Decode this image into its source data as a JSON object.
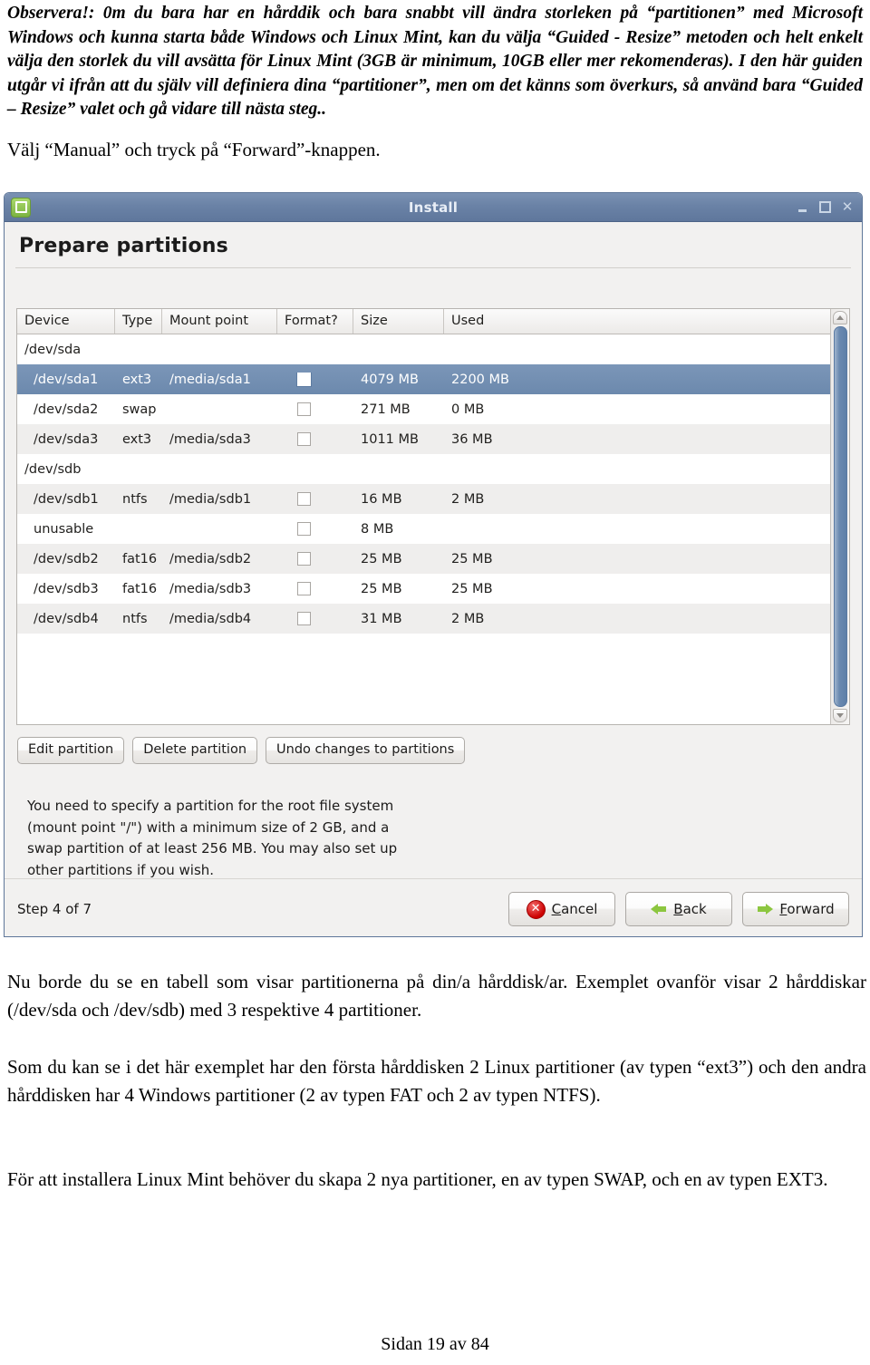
{
  "document": {
    "intro_paragraph": "Observera!: 0m du bara har en hårddik och bara snabbt vill ändra storleken på “partitionen” med Microsoft Windows och kunna starta både Windows och Linux Mint, kan du välja “Guided - Resize” metoden och helt enkelt  välja den storlek du vill avsätta för Linux Mint (3GB är minimum, 10GB eller mer rekomenderas). I den här guiden utgår vi ifrån att du själv vill definiera dina “partitioner”, men om det känns som överkurs, så använd  bara “Guided – Resize” valet och gå vidare till nästa steg..",
    "instruction": "Välj “Manual” och tryck på “Forward”-knappen.",
    "after_paragraph_1": "Nu borde du se en tabell som visar partitionerna på din/a hårddisk/ar. Exemplet ovanför visar  2 hårddiskar (/dev/sda och /dev/sdb) med 3 respektive 4 partitioner.",
    "after_paragraph_2": "Som du kan se i det här exemplet har den första hårddisken 2 Linux partitioner (av typen “ext3”) och den andra hårddisken  har 4 Windows partitioner (2 av typen FAT och 2 av typen NTFS).",
    "after_paragraph_3": "För att installera Linux Mint behöver du skapa  2 nya partitioner, en av typen SWAP, och en av typen EXT3.",
    "footer": "Sidan 19 av 84"
  },
  "window": {
    "title": "Install",
    "icon": "linux-mint-logo",
    "controls": {
      "minimize": "_",
      "maximize": "□",
      "close": "✕"
    },
    "heading": "Prepare partitions",
    "table": {
      "columns": [
        "Device",
        "Type",
        "Mount point",
        "Format?",
        "Size",
        "Used"
      ],
      "rows": [
        {
          "kind": "disk",
          "device": "/dev/sda",
          "type": "",
          "mount": "",
          "format": false,
          "has_checkbox": false,
          "size": "",
          "used": "",
          "selected": false,
          "alt": false
        },
        {
          "kind": "partition",
          "device": "/dev/sda1",
          "type": "ext3",
          "mount": "/media/sda1",
          "format": false,
          "has_checkbox": true,
          "size": "4079 MB",
          "used": "2200 MB",
          "selected": true,
          "alt": false
        },
        {
          "kind": "partition",
          "device": "/dev/sda2",
          "type": "swap",
          "mount": "",
          "format": false,
          "has_checkbox": true,
          "size": "271 MB",
          "used": "0 MB",
          "selected": false,
          "alt": false
        },
        {
          "kind": "partition",
          "device": "/dev/sda3",
          "type": "ext3",
          "mount": "/media/sda3",
          "format": false,
          "has_checkbox": true,
          "size": "1011 MB",
          "used": "36 MB",
          "selected": false,
          "alt": true
        },
        {
          "kind": "disk",
          "device": "/dev/sdb",
          "type": "",
          "mount": "",
          "format": false,
          "has_checkbox": false,
          "size": "",
          "used": "",
          "selected": false,
          "alt": false
        },
        {
          "kind": "partition",
          "device": "/dev/sdb1",
          "type": "ntfs",
          "mount": "/media/sdb1",
          "format": false,
          "has_checkbox": true,
          "size": "16 MB",
          "used": "2 MB",
          "selected": false,
          "alt": true
        },
        {
          "kind": "partition",
          "device": "unusable",
          "type": "",
          "mount": "",
          "format": false,
          "has_checkbox": true,
          "size": "8 MB",
          "used": "",
          "selected": false,
          "alt": false
        },
        {
          "kind": "partition",
          "device": "/dev/sdb2",
          "type": "fat16",
          "mount": "/media/sdb2",
          "format": false,
          "has_checkbox": true,
          "size": "25 MB",
          "used": "25 MB",
          "selected": false,
          "alt": true
        },
        {
          "kind": "partition",
          "device": "/dev/sdb3",
          "type": "fat16",
          "mount": "/media/sdb3",
          "format": false,
          "has_checkbox": true,
          "size": "25 MB",
          "used": "25 MB",
          "selected": false,
          "alt": false
        },
        {
          "kind": "partition",
          "device": "/dev/sdb4",
          "type": "ntfs",
          "mount": "/media/sdb4",
          "format": false,
          "has_checkbox": true,
          "size": "31 MB",
          "used": "2 MB",
          "selected": false,
          "alt": true
        }
      ]
    },
    "buttons": {
      "edit_partition": "Edit partition",
      "delete_partition": "Delete partition",
      "undo_changes": "Undo changes to partitions"
    },
    "help_text": "You need to specify a partition for the root file system (mount point \"/\") with a minimum size of 2 GB, and a swap partition of at least 256 MB. You may also set up other partitions if you wish.",
    "footer": {
      "step": "Step 4 of 7",
      "cancel": "Cancel",
      "cancel_mnemonic": "C",
      "cancel_rest": "ancel",
      "back": "Back",
      "back_mnemonic": "B",
      "back_rest": "ack",
      "forward": "Forward",
      "forward_mnemonic": "F",
      "forward_rest": "orward"
    }
  },
  "colors": {
    "titlebar": "#6a82a6",
    "selection": "#6c89ad",
    "accent_green": "#8cc63f",
    "cancel_red": "#cc0000"
  }
}
